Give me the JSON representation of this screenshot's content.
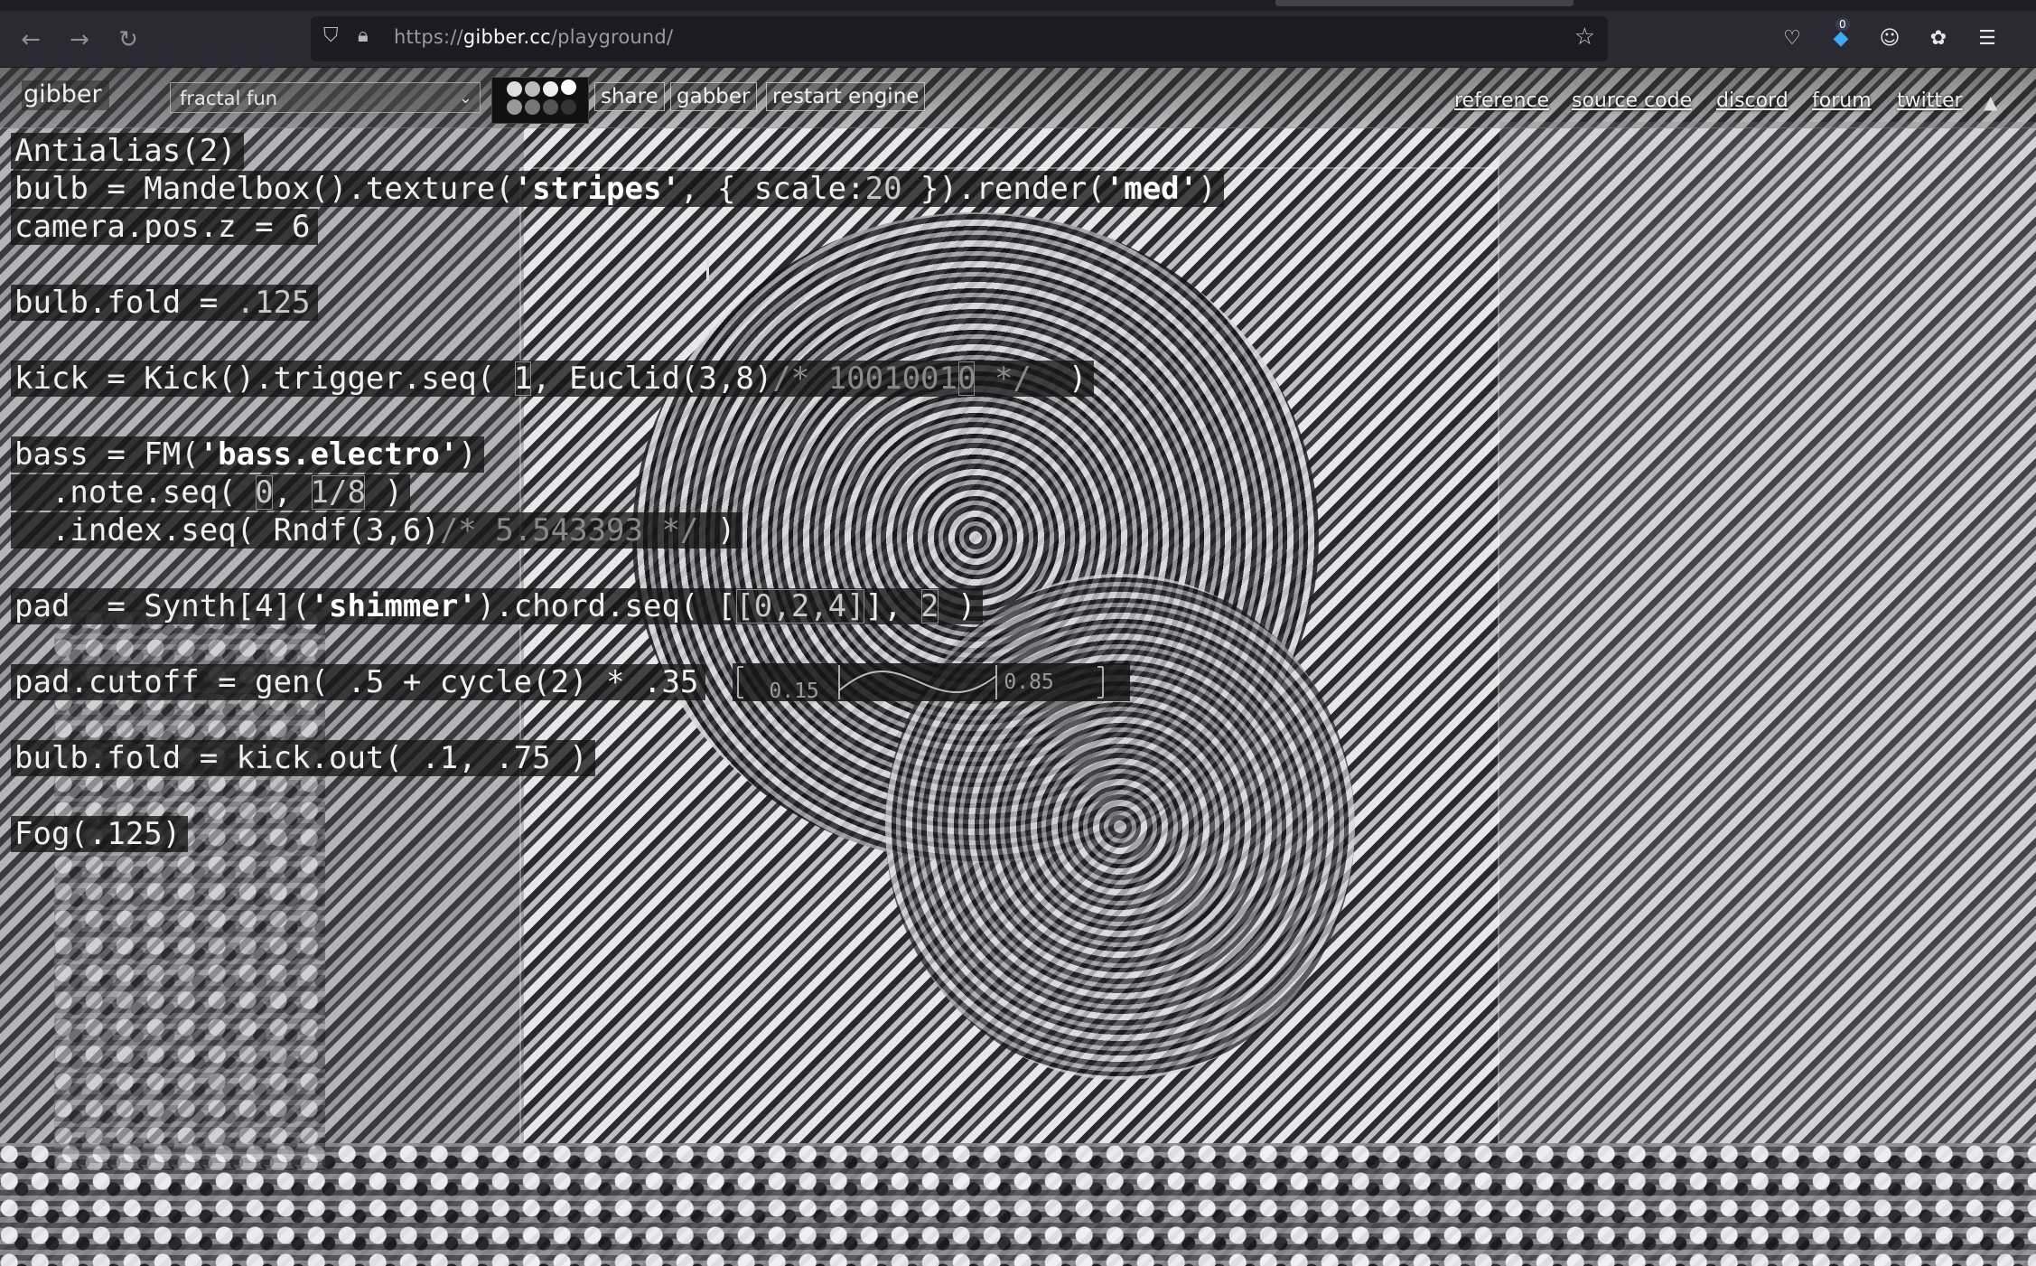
{
  "browser": {
    "url_protocol": "https://",
    "url_host": "gibber.cc",
    "url_path": "/playground/",
    "notification_count": "0"
  },
  "app": {
    "logo": "gibber",
    "example_select": "fractal fun",
    "buttons": {
      "share": "share",
      "gabber": "gabber",
      "restart": "restart engine"
    },
    "nav": [
      "reference",
      "source code",
      "discord",
      "forum",
      "twitter"
    ],
    "collapse_glyph": "▲"
  },
  "code": {
    "l1": "Antialias(2)",
    "l2a": "bulb = Mandelbox().texture(",
    "l2b": "'stripes'",
    "l2c": ", { scale:",
    "l2d": "20",
    "l2e": " }).render(",
    "l2f": "'med'",
    "l2g": ")",
    "l3": "camera.pos.z = 6",
    "l4a": "bulb.fold = ",
    "l4b": ".125",
    "l5a": "kick = Kick().trigger.seq( ",
    "l5b": "1",
    "l5c": ", Euclid(3,8)",
    "l5d": "/* 1001001",
    "l5e": "0",
    "l5f": " */  ",
    "l5g": ")",
    "l6a": "bass = FM(",
    "l6b": "'bass.electro'",
    "l6c": ")",
    "l7a": "  .note.seq( ",
    "l7b": "0",
    "l7c": ", ",
    "l7d": "1/8",
    "l7e": " )",
    "l8a": "  .index.seq( Rndf(3,6)",
    "l8b": "/* 5.543393 */",
    "l8c": " )",
    "l9a": "pad  = Synth[4](",
    "l9b": "'shimmer'",
    "l9c": ").chord.seq( [",
    "l9d": "[0,2,4]",
    "l9e": "], ",
    "l9f": "2",
    "l9g": " )",
    "l10": "pad.cutoff = gen( .5 + cycle(2) * .35",
    "l10_low": "0.15",
    "l10_high": "0.85",
    "l11": "bulb.fold = kick.out( .1, .75 )",
    "l12": "Fog(.125)"
  },
  "colors": {
    "highlight_bg": "#141414",
    "text": "#f0f0f0",
    "comment": "#8a8a8a",
    "chrome_bg": "#2b2a33"
  }
}
